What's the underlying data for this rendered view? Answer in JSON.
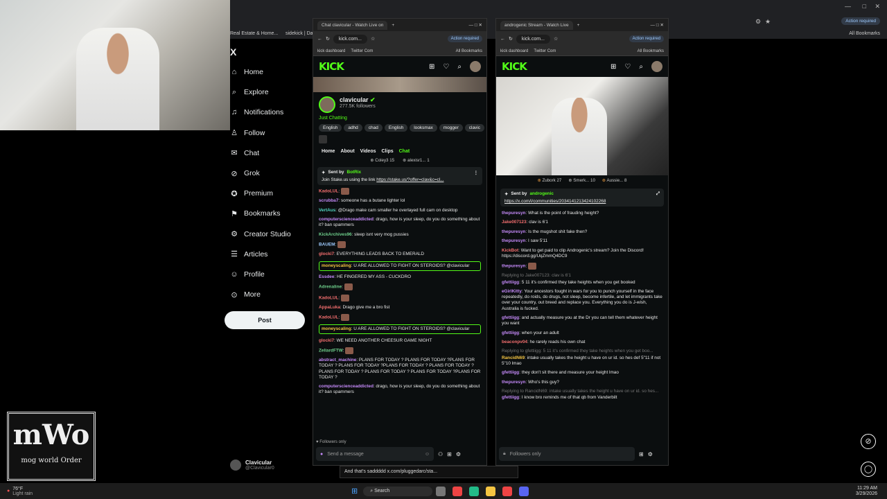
{
  "browser": {
    "bookmarks": [
      "Real Estate & Home...",
      "sidekick | Dashb"
    ],
    "action_required": "Action required",
    "all_bookmarks": "All Bookmarks"
  },
  "x_sidebar": {
    "logo": "X",
    "items": [
      {
        "label": "Home",
        "icon": "home-icon"
      },
      {
        "label": "Explore",
        "icon": "search-icon"
      },
      {
        "label": "Notifications",
        "icon": "bell-icon"
      },
      {
        "label": "Follow",
        "icon": "follow-icon"
      },
      {
        "label": "Chat",
        "icon": "mail-icon"
      },
      {
        "label": "Grok",
        "icon": "grok-icon"
      },
      {
        "label": "Premium",
        "icon": "premium-icon"
      },
      {
        "label": "Bookmarks",
        "icon": "bookmark-icon"
      },
      {
        "label": "Creator Studio",
        "icon": "creator-icon"
      },
      {
        "label": "Articles",
        "icon": "articles-icon"
      },
      {
        "label": "Profile",
        "icon": "profile-icon"
      },
      {
        "label": "More",
        "icon": "more-icon"
      }
    ],
    "post_label": "Post",
    "account_name": "Clavicular",
    "account_handle": "@Clavicular0"
  },
  "logo_text": {
    "top": "mWo",
    "bottom": "mog world Order"
  },
  "left_window": {
    "tab_title": "Chat clavicular - Watch Live on",
    "url": "kick.com...",
    "bookmarks": [
      "kick dashboard",
      "Twitter Com"
    ],
    "channel": "clavicular",
    "followers": "277.5K followers",
    "category": "Just Chatting",
    "tags": [
      "English",
      "adhd",
      "chad",
      "English",
      "looksmax",
      "mogger",
      "clavic"
    ],
    "nav": [
      "Home",
      "About",
      "Videos",
      "Clips",
      "Chat"
    ],
    "gifters": [
      "Coley3 15",
      "alexisr1... 1"
    ],
    "pinned_by": "Sent by",
    "pinned_user": "BotRix",
    "pinned_text": "Join Stake.us using the link",
    "pinned_link": "https://stake.us/?offer=clav&c=cl...",
    "messages": [
      {
        "user": "KadoLUL",
        "text": "",
        "color": "#f46f6f"
      },
      {
        "user": "scrubba7",
        "text": "someone has a butane lighter lol",
        "color": "#c58af9"
      },
      {
        "user": "VertAus",
        "text": "@Drago make cam smaller he overlayed full cam on desktop",
        "color": "#53d6c3"
      },
      {
        "user": "computerscienceaddicted",
        "text": "drago, how is your sleep, do you do something about it? ban spammers",
        "color": "#c58af9"
      },
      {
        "user": "KickArchives96",
        "text": "sleep isnt very mog pussies",
        "color": "#6fd08c"
      },
      {
        "user": "BAUEM",
        "text": "",
        "color": "#9ecbff"
      },
      {
        "user": "glocki7",
        "text": "EVERYTHING LEADS BACK TO EMERALD",
        "color": "#f46f6f"
      },
      {
        "user": "moneyscaling",
        "text": "U ARE ALLOWED TO FIGHT ON STEROIDS? @clavicular",
        "color": "#f5c542",
        "hl": true
      },
      {
        "user": "Essdee",
        "text": "HE FINGERED MY ASS - CUCKDRO",
        "color": "#c58af9"
      },
      {
        "user": "Adrenaline",
        "text": "",
        "color": "#6fd08c"
      },
      {
        "user": "KadoLUL",
        "text": "",
        "color": "#f46f6f"
      },
      {
        "user": "AppaLuka",
        "text": "Drago give me a bro fist",
        "color": "#f46f6f"
      },
      {
        "user": "KadoLUL",
        "text": "",
        "color": "#f46f6f"
      },
      {
        "user": "moneyscaling",
        "text": "U ARE ALLOWED TO FIGHT ON STEROIDS? @clavicular",
        "color": "#f5c542",
        "hl": true
      },
      {
        "user": "glocki7",
        "text": "WE NEED ANOTHER CHEESUR GAME NIGHT",
        "color": "#f46f6f"
      },
      {
        "user": "ZeliardFTW",
        "text": "",
        "color": "#6fd08c"
      },
      {
        "user": "abstract_machine",
        "text": "PLANS FOR TODAY ? PLANS FOR TODAY ?PLANS FOR TODAY ? PLANS FOR TODAY ?PLANS FOR TODAY ? PLANS FOR TODAY ?PLANS FOR TODAY ? PLANS FOR TODAY ? PLANS FOR TODAY ?PLANS FOR TODAY ?",
        "color": "#c58af9"
      },
      {
        "user": "computerscienceaddicted",
        "text": "drago, how is your sleep, do you do something about it? ban spammers",
        "color": "#c58af9"
      }
    ],
    "followers_only": "Followers only",
    "input_placeholder": "Send a message"
  },
  "right_window": {
    "tab_title": "androgenic Stream - Watch Live",
    "url": "kick.com...",
    "bookmarks": [
      "kick dashboard",
      "Twitter Com"
    ],
    "gifters": [
      "Zubork 27",
      "Smerk... 10",
      "Aussie... 8"
    ],
    "pinned_by": "Sent by",
    "pinned_user": "androgenic",
    "pinned_link": "https://x.com/i/communities/2034141213424102268",
    "messages": [
      {
        "user": "thepuresyn",
        "text": "What is the point of frauding height?",
        "color": "#c58af9"
      },
      {
        "user": "Jake007123",
        "text": "clav is 6'1",
        "color": "#f46f6f"
      },
      {
        "user": "thepuresyn",
        "text": "Is the mugshot shit fake then?",
        "color": "#c58af9"
      },
      {
        "user": "thepuresyn",
        "text": "I saw 5'11",
        "color": "#c58af9"
      },
      {
        "user": "KickBot",
        "text": "Want to get paid to clip Androgenic's stream? Join the Discord! https://discord.gg/UqZmmQ4DC9",
        "color": "#f46f6f"
      },
      {
        "user": "thepuresyn",
        "text": "",
        "color": "#c58af9"
      },
      {
        "user": "gfettiigg",
        "text": "5 11 it's confirmed they take heights when you get booked",
        "color": "#c58af9",
        "reply": "Replying to Jake007123: clav is 6'1"
      },
      {
        "user": "eGirlKitty",
        "text": "Your ancestors fought in wars for you to punch yourself in the face repeatedly, do roids, do drugs, not sleep, become infertile, and let immigrants take over your country, out breed and replace you. Everything you do is J-wish, Australia is fucked.",
        "color": "#c58af9"
      },
      {
        "user": "gfettiigg",
        "text": "and actually measure you at the Dr you can tell them whatever height you want",
        "color": "#c58af9"
      },
      {
        "user": "gfettiigg",
        "text": "when your an adult",
        "color": "#c58af9"
      },
      {
        "user": "beaconpv04",
        "text": "he rarely reads his own chat",
        "color": "#f46f6f"
      },
      {
        "user": "RancidN69",
        "text": "intake usually takes the height u have on ur id. so hes def 5\"11 if not 5\"10 lmao",
        "color": "#f5c542",
        "reply": "Replying to gfettiigg: 5 11 it's confirmed they take heights when you get boo..."
      },
      {
        "user": "gfettiigg",
        "text": "they don't sit there and measure your height lmao",
        "color": "#c58af9"
      },
      {
        "user": "thepuresyn",
        "text": "Who's this guy?",
        "color": "#c58af9"
      },
      {
        "user": "gfettiigg",
        "text": "I know bro reminds me of that qb from Vanderbilt",
        "color": "#c58af9",
        "reply": "Replying to RancidN69: intake usually takes the height u have on ur id. so hes..."
      }
    ],
    "input_placeholder": "Followers only"
  },
  "overlay_text": "And that's saddddd x.com/pluggedarc/sta...",
  "taskbar": {
    "weather_temp": "76°F",
    "weather_text": "Light rain",
    "search": "Search",
    "time": "11:29 AM",
    "date": "3/29/2026"
  }
}
